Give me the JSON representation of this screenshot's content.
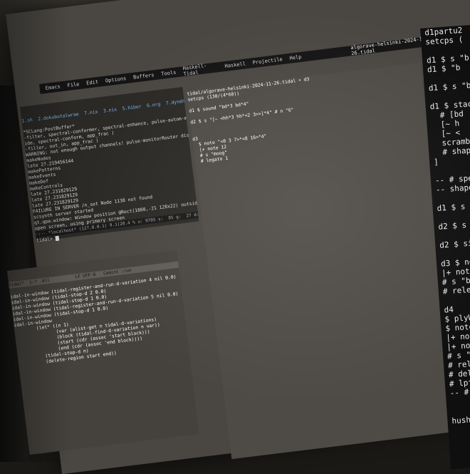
{
  "window": {
    "title": "algorave-helsinki-2024-11-26.tidal",
    "menu": [
      "Emacs",
      "File",
      "Edit",
      "Options",
      "Buffers",
      "Tools",
      "Haskell-Tidal",
      "Haskell",
      "Projectile",
      "Help"
    ],
    "tabs": "1.sh  2.dokubotalwrae  7.nix  3.nix  5.hiber  6.org  7.dyndns"
  },
  "left_top": {
    "lines": [
      "*SCLang:PostBuffer*",
      "-filter, spectral-conformer, spectral-enhance, pulse-autom-maximizer, dj",
      "ide, spectral-conform, app_frac )",
      "-filler, out_in, app_frac )",
      "WARNING: not enough output channels! pulse-monitorRouter disabled",
      "makeNodes",
      "late 27.219456144",
      "makePatterns",
      "makeEvents",
      "makeDef",
      "makeControls",
      "late 27.231829129",
      "late 27.231829129",
      "late 27.231829129",
      "FAILURE IN SERVER /n_set Node 1138 not found",
      "scsynth server started",
      "qt.qpa.window: Window position @Rect(1880,-21 128x22) outside any k",
      "open screen, using primary screen"
    ],
    "modeline": "-:-- *localhost* (127.0.0.1) 9.1(20.4 % u: 9705 s:  85 g:  27 d:  291",
    "prompt": "tidal> "
  },
  "right": {
    "lines": [
      "tidal/algorave-helsinki-2024-11-26.tidal ∙ d3",
      "setcps (130/(4*60))",
      "",
      "d1 $ sound \"bd*3 bd*4\"",
      "",
      "d2 $ s \"[~ <hh*3 hh*<2 3>>]*4\" # n \"6\"",
      "",
      "",
      "d3",
      "  $ note \"<0 3 7>*<8 16>*4\"",
      "  |+ note 12",
      "  # s \"moog\"",
      "  # legato 1"
    ]
  },
  "left_bottom": {
    "modeline": "tidal*  1:?  All          LF UTF-8   Comint :run",
    "lines": [
      "idal-in-window (tidal-register-and-run-d-variation 4 nil 0.0)",
      "idal-in-window (tidal-stop-d 2 0.0)",
      "idal-in-window (tidal-stop-d 1 0.0)",
      "idal-in-window (tidal-register-and-run-d-variation 5 nil 0.0)",
      "idal-in-window (tidal-stop-d 1 0.0)",
      "idal-in-window",
      "        (let* ((n 1)",
      "               (var (alist-get n tidal-d-variations)",
      "               (block (tidal-find-d-variation n var))",
      "               (start (cdr (assoc 'start block)))",
      "               (end (cdr (assoc 'end block))))",
      "          (tidal-stop-d n)",
      "          (delete-region start end))"
    ]
  },
  "right_panel": {
    "lines": [
      "d1partu2",
      "setcps (",
      "",
      "d1 $ s \"b",
      "d1 $ \"b",
      "",
      "d1 $ s \"b",
      "",
      "d1 $ stack",
      "  # [bd",
      "  [~ h",
      "  [~ <",
      "  scramble",
      "  # shape",
      "]",
      "",
      "-- # speed",
      "-- shape (r",
      "",
      "d1 $ s \"b",
      "",
      "d2 $ s \"p",
      "",
      "d2 $ silen",
      "",
      "d3 $ note",
      "|+ note (s",
      "# s \"bass3",
      "# release",
      "",
      "d4",
      "$ plyWith",
      "$ note \"<0",
      "|+ note (1",
      "|+ note \"<",
      "# s \"gtr:0",
      "# release (",
      "# delay 0.3",
      "# lpf 800 (",
      "-- # room",
      "",
      "",
      "hush"
    ]
  }
}
